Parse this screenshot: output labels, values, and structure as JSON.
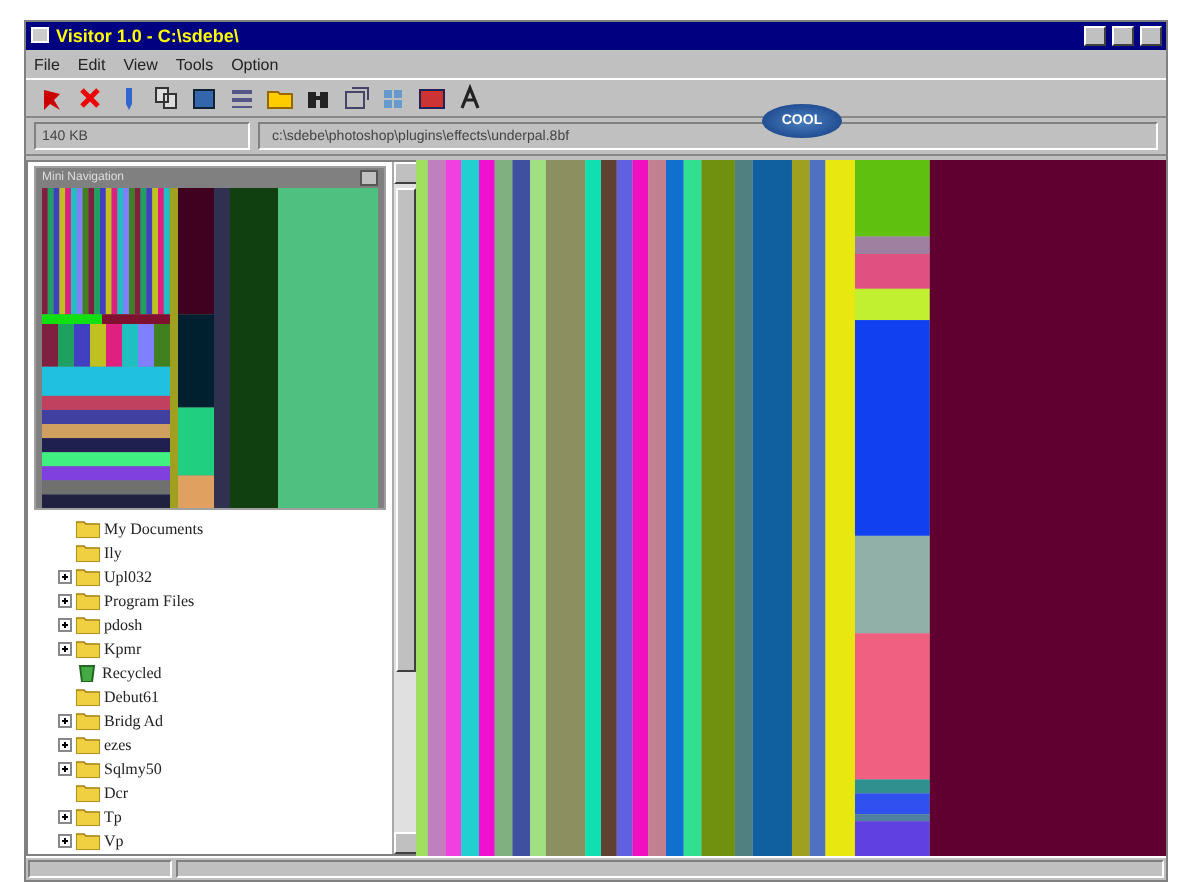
{
  "window": {
    "title": "Visitor 1.0 - C:\\sdebe\\"
  },
  "menu": [
    "File",
    "Edit",
    "View",
    "Tools",
    "Option"
  ],
  "address": {
    "size": "140 KB",
    "path": "c:\\sdebe\\photoshop\\plugins\\effects\\underpal.8bf"
  },
  "logo": {
    "text": "COOL"
  },
  "navigator": {
    "title": "Mini Navigation"
  },
  "tree": [
    {
      "label": "My Documents",
      "expandable": false
    },
    {
      "label": "Ily",
      "expandable": false
    },
    {
      "label": "Upl032",
      "expandable": true
    },
    {
      "label": "Program Files",
      "expandable": true
    },
    {
      "label": "pdosh",
      "expandable": true
    },
    {
      "label": "Kpmr",
      "expandable": true
    },
    {
      "label": "Recycled",
      "expandable": false,
      "kind": "recycle"
    },
    {
      "label": "Debut61",
      "expandable": false
    },
    {
      "label": "Bridg Ad",
      "expandable": true
    },
    {
      "label": "ezes",
      "expandable": true
    },
    {
      "label": "Sqlmy50",
      "expandable": true
    },
    {
      "label": "Dcr",
      "expandable": false
    },
    {
      "label": "Tp",
      "expandable": true
    },
    {
      "label": "Vp",
      "expandable": true
    }
  ]
}
